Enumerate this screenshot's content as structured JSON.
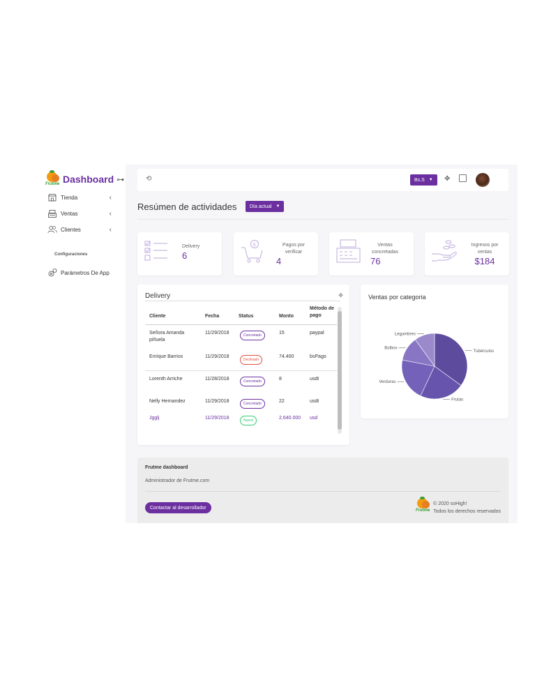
{
  "brand": {
    "title": "Dashboard",
    "logo_text": "Frutme"
  },
  "sidebar": {
    "items": [
      {
        "label": "Tienda",
        "icon": "store-icon"
      },
      {
        "label": "Ventas",
        "icon": "cash-register-icon"
      },
      {
        "label": "Clientes",
        "icon": "users-icon"
      }
    ],
    "section_label": "Configuraciones",
    "settings_item": {
      "label": "Parámetros De App",
      "icon": "gears-icon"
    }
  },
  "topbar": {
    "currency_label": "Bs.S"
  },
  "page": {
    "title": "Resúmen de actividades",
    "period_label": "Día actual"
  },
  "stats": [
    {
      "label": "Delivery",
      "value": "6",
      "icon": "checklist-icon"
    },
    {
      "label": "Pagos por verificar",
      "value": "4",
      "icon": "shopping-cart-icon"
    },
    {
      "label": "Ventas concretadas",
      "value": "76",
      "icon": "cash-register-icon"
    },
    {
      "label": "Ingresos por ventas",
      "value": "$184",
      "icon": "money-hand-icon"
    }
  ],
  "delivery_table": {
    "title": "Delivery",
    "headers": [
      "Cliente",
      "Fecha",
      "Status",
      "Monto",
      "Método de pago"
    ],
    "rows": [
      {
        "cliente": "Señora Amanda piñuela",
        "fecha": "11/29/2018",
        "status": "Concretado",
        "monto": "15",
        "metodo": "paypal",
        "status_color": "#6b2fa0"
      },
      {
        "cliente": "Enrique Barrios",
        "fecha": "11/29/2018",
        "status": "Declinado",
        "monto": "74.400",
        "metodo": "bsPago",
        "status_color": "#e74c3c"
      },
      {
        "cliente": "Lorenth Arriche",
        "fecha": "11/28/2018",
        "status": "Concretado",
        "monto": "8",
        "metodo": "usdt",
        "status_color": "#6b2fa0"
      },
      {
        "cliente": "Nelly Hernandez",
        "fecha": "11/29/2018",
        "status": "Concretado",
        "monto": "22",
        "metodo": "usdt",
        "status_color": "#6b2fa0"
      },
      {
        "cliente": "Jgglj",
        "fecha": "11/29/2018",
        "status": "Nuevo",
        "monto": "2,640.000",
        "metodo": "usd",
        "status_color": "#2ecc71"
      }
    ]
  },
  "chart_panel": {
    "title": "Ventas por categoria"
  },
  "chart_data": {
    "type": "pie",
    "title": "Ventas por categoria",
    "slices": [
      {
        "label": "Tubérculos",
        "value": 35,
        "color": "#5d4b9e"
      },
      {
        "label": "Frutas",
        "value": 22,
        "color": "#6654ad"
      },
      {
        "label": "Verduras",
        "value": 21,
        "color": "#7462ba"
      },
      {
        "label": "Bulbos",
        "value": 12,
        "color": "#8876c4"
      },
      {
        "label": "Legumbres",
        "value": 10,
        "color": "#9a8acc"
      }
    ]
  },
  "footer": {
    "title": "Frutme dashboard",
    "subtitle": "Administrador de Frutme.com",
    "contact_label": "Contactar al desarrollador",
    "copyright": "© 2020 soHigh!",
    "rights": "Todos los derechos reservados"
  }
}
